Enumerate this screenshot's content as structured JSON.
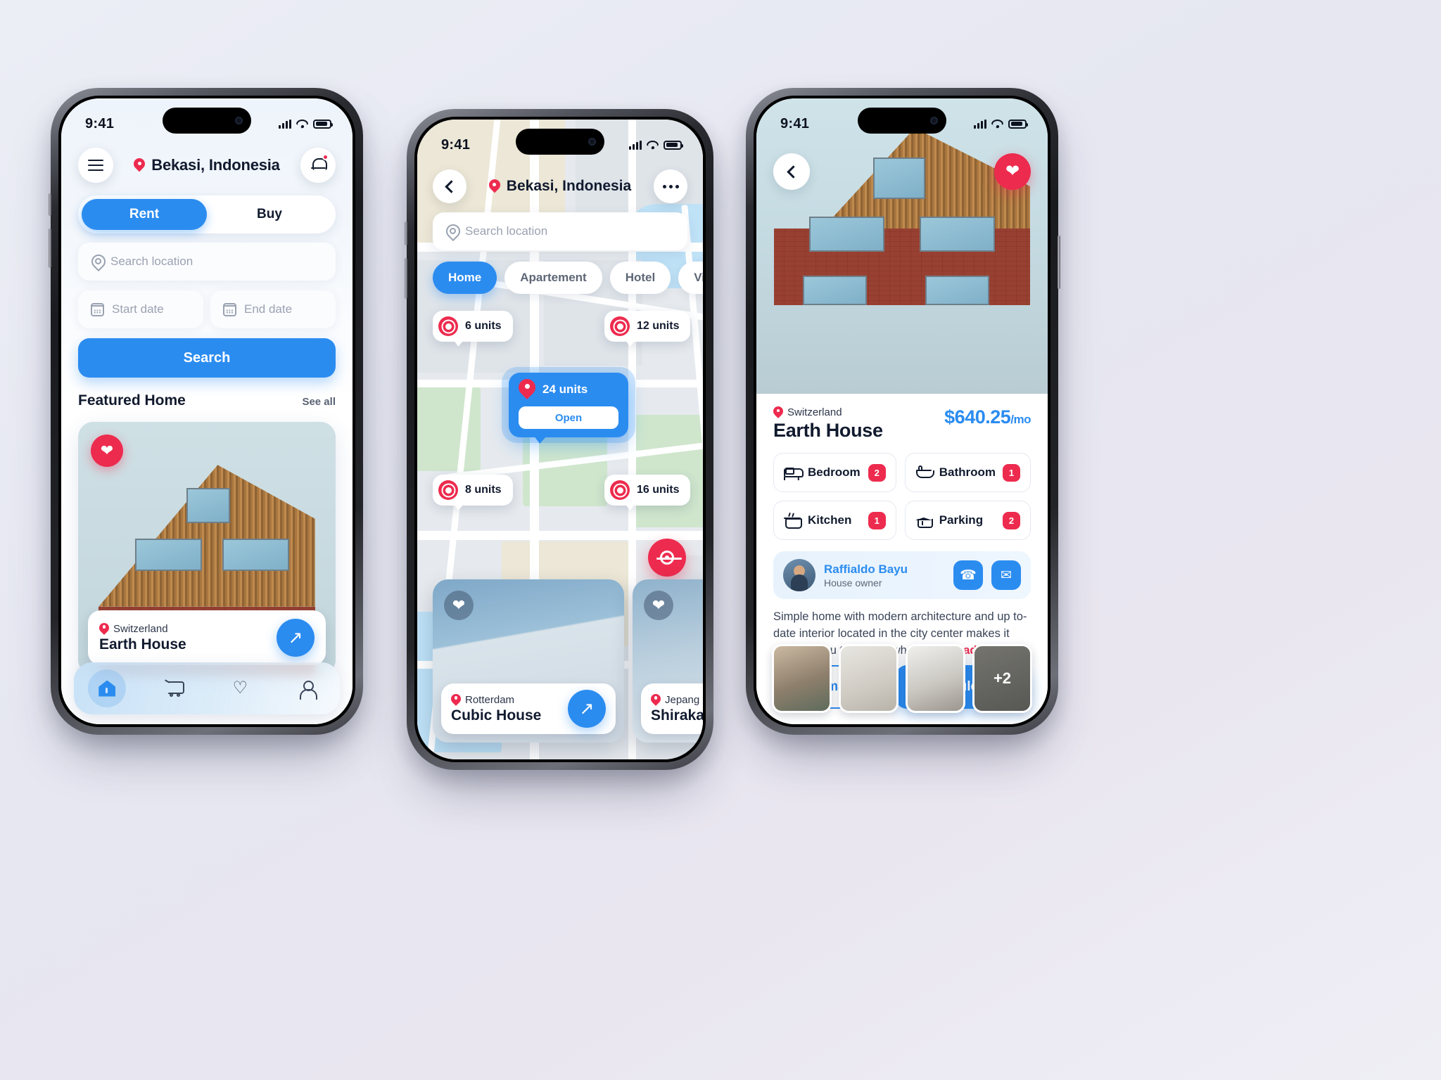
{
  "status_bar": {
    "time": "9:41",
    "icons": [
      "signal-icon",
      "wifi-icon",
      "battery-icon"
    ]
  },
  "colors": {
    "primary": "#2b8cf0",
    "accent": "#ed2b4e",
    "text": "#111a2e",
    "muted": "#9aa2b1"
  },
  "phone1": {
    "header": {
      "menu_icon": "hamburger-icon",
      "location": "Bekasi, Indonesia",
      "bell_icon": "bell-icon"
    },
    "segments": [
      {
        "label": "Rent",
        "active": true
      },
      {
        "label": "Buy",
        "active": false
      }
    ],
    "search_placeholder": "Search location",
    "start_date_placeholder": "Start date",
    "end_date_placeholder": "End date",
    "search_button": "Search",
    "section": {
      "title": "Featured Home",
      "see_all": "See all"
    },
    "featured_card": {
      "favorite_icon": "heart-icon",
      "location": "Switzerland",
      "name": "Earth House",
      "open_icon": "arrow-up-right-icon"
    },
    "tabbar": [
      {
        "name": "home",
        "icon": "home-icon",
        "active": true
      },
      {
        "name": "cart",
        "icon": "cart-icon",
        "active": false
      },
      {
        "name": "favorites",
        "icon": "heart-icon",
        "active": false
      },
      {
        "name": "profile",
        "icon": "user-icon",
        "active": false
      }
    ]
  },
  "phone2": {
    "header": {
      "back_icon": "chevron-left-icon",
      "location": "Bekasi, Indonesia",
      "more_icon": "more-horizontal-icon"
    },
    "search_placeholder": "Search location",
    "chips": [
      {
        "label": "Home",
        "active": true
      },
      {
        "label": "Apartement",
        "active": false
      },
      {
        "label": "Hotel",
        "active": false
      },
      {
        "label": "Villa",
        "active": false
      }
    ],
    "markers": [
      {
        "label": "6 units"
      },
      {
        "label": "12 units"
      },
      {
        "label": "8 units"
      },
      {
        "label": "16 units"
      }
    ],
    "selected_marker": {
      "label": "24 units",
      "action": "Open"
    },
    "gps_icon": "locate-icon",
    "cards": [
      {
        "location": "Rotterdam",
        "name": "Cubic House",
        "favorite_icon": "heart-icon",
        "open_icon": "arrow-up-right-icon"
      },
      {
        "location": "Jepang",
        "name": "Shirakawa",
        "favorite_icon": "heart-icon"
      }
    ]
  },
  "phone3": {
    "back_icon": "chevron-left-icon",
    "favorite_icon": "heart-icon",
    "thumbnails": [
      {
        "name": "bedroom-thumb"
      },
      {
        "name": "living-thumb"
      },
      {
        "name": "kitchen-thumb"
      },
      {
        "name": "garage-thumb",
        "more_label": "+2"
      }
    ],
    "location": "Switzerland",
    "price": "$640.25",
    "price_unit": "/mo",
    "title": "Earth House",
    "features": [
      {
        "icon": "bed-icon",
        "label": "Bedroom",
        "count": "2"
      },
      {
        "icon": "bath-icon",
        "label": "Bathroom",
        "count": "1"
      },
      {
        "icon": "kitchen-icon",
        "label": "Kitchen",
        "count": "1"
      },
      {
        "icon": "parking-icon",
        "label": "Parking",
        "count": "2"
      }
    ],
    "owner": {
      "name": "Raffialdo Bayu",
      "role": "House owner",
      "call_icon": "phone-icon",
      "chat_icon": "chat-icon"
    },
    "description": "Simple home with modern architecture and up to-date interior located in the city center makes it easy for you to access whole city. ",
    "read_more": "Read more...",
    "actions": {
      "secondary": "Estimate",
      "primary": "Schedule tour"
    }
  }
}
